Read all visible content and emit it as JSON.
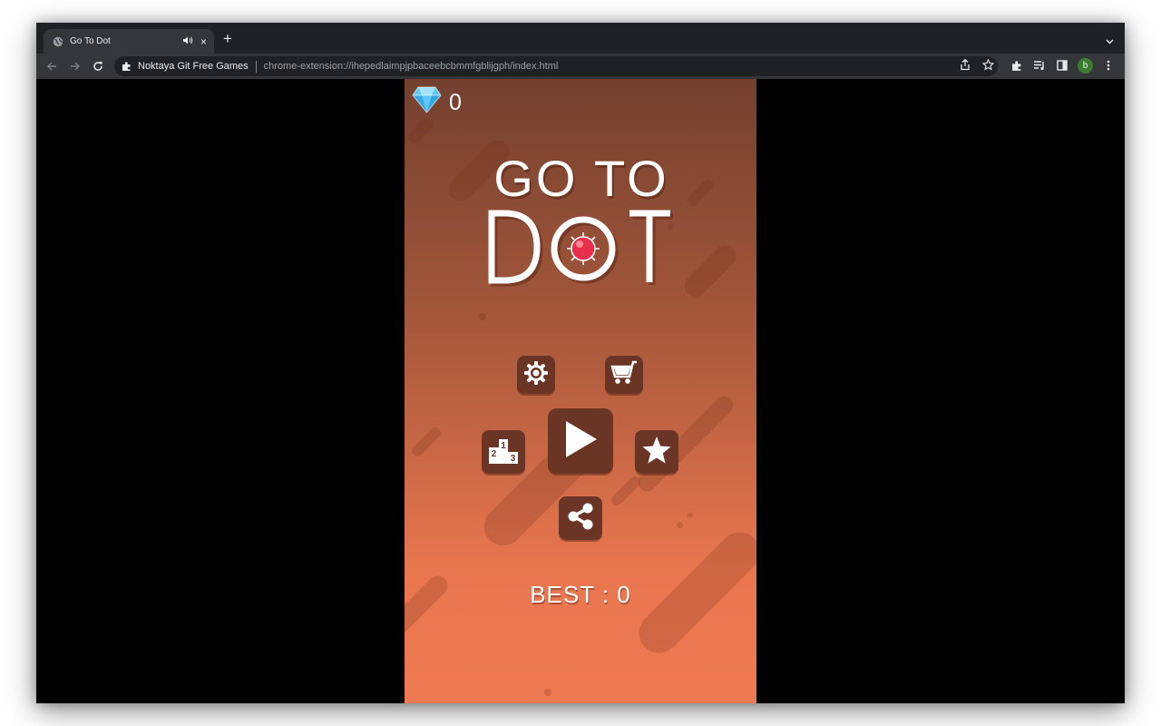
{
  "browser": {
    "tab": {
      "title": "Go To Dot",
      "favicon": "globe-icon",
      "audio": "speaker-icon",
      "close": "×"
    },
    "new_tab": "+",
    "address": {
      "site_name": "Noktaya Git Free Games",
      "url": "chrome-extension://ihepedlaimpjpbaceebcbmmfgblijgph/index.html"
    },
    "profile_initial": "b"
  },
  "game": {
    "gems": "0",
    "title_line1": "GO TO",
    "title_line2": "DOT",
    "best_label": "BEST : 0",
    "colors": {
      "button": "#6a3525",
      "gem": "#5ec8f5",
      "dot": "#e8304a",
      "bg_top": "#73402f",
      "bg_bottom": "#ef7a52"
    },
    "buttons": [
      {
        "name": "settings",
        "icon": "gear-icon"
      },
      {
        "name": "shop",
        "icon": "cart-icon"
      },
      {
        "name": "leaderboard",
        "icon": "podium-icon"
      },
      {
        "name": "play",
        "icon": "play-icon"
      },
      {
        "name": "rate",
        "icon": "star-icon"
      },
      {
        "name": "share",
        "icon": "share-icon"
      }
    ]
  }
}
